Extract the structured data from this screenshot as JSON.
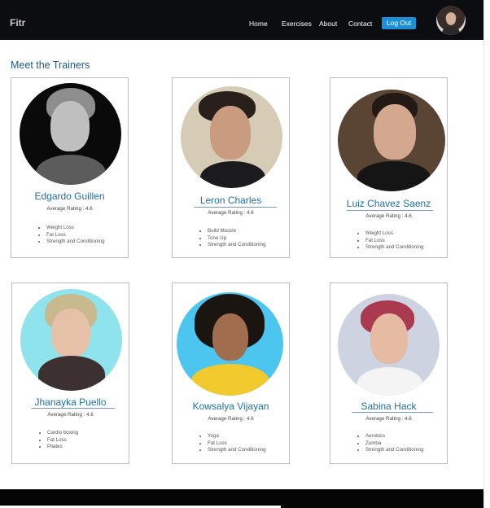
{
  "navbar": {
    "brand": "Fitr",
    "links": [
      "Home",
      "Exercises",
      "About",
      "Contact"
    ],
    "logout_label": "Log Out"
  },
  "section_title": "Meet the Trainers",
  "rating_label": "Average Rating : 4.6",
  "trainers": [
    {
      "name": "Edgardo Guillen",
      "rating": 4.6,
      "skills": [
        "Weight Loss",
        "Fat Loss",
        "Strength and Conditioning"
      ]
    },
    {
      "name": "Leron Charles",
      "rating": 4.6,
      "skills": [
        "Build Muscle",
        "Tone Up",
        "Strength and Conditioning"
      ]
    },
    {
      "name": "Luiz Chavez Saenz",
      "rating": 4.6,
      "skills": [
        "Weight Loss",
        "Fat Loss",
        "Strength and Conditioning"
      ]
    },
    {
      "name": "Jhanayka Puello",
      "rating": 4.6,
      "skills": [
        "Cardio boxing",
        "Fat Loss",
        "Pilates"
      ]
    },
    {
      "name": "Kowsalya Vijayan",
      "rating": 4.6,
      "skills": [
        "Yoga",
        "Fat Loss",
        "Strength and Conditioning"
      ]
    },
    {
      "name": "Sabina Hack",
      "rating": 4.6,
      "skills": [
        "Aerobics",
        "Zumba",
        "Strength and Conditioning"
      ]
    }
  ],
  "colors": {
    "navbar_bg": "#0c0d11",
    "accent_button": "#1b8fd8",
    "name_text": "#1f6fa3",
    "section_title": "#1a5d8c"
  }
}
